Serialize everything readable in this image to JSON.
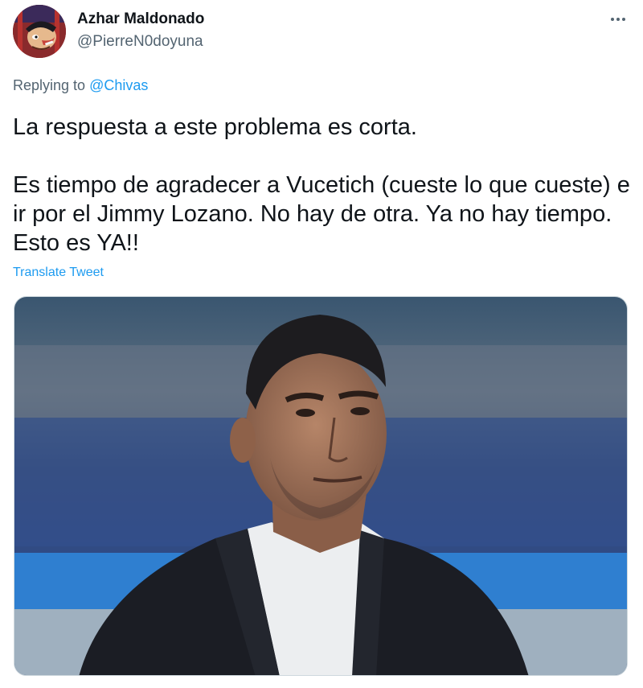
{
  "author": {
    "display_name": "Azhar Maldonado",
    "handle": "@PierreN0doyuna",
    "avatar_icon": "cartoon-avatar"
  },
  "reply": {
    "prefix": "Replying to",
    "mention": "@Chivas"
  },
  "tweet": {
    "paragraphs": [
      "La respuesta a este problema es corta.",
      "Es tiempo de agradecer a Vucetich (cueste lo que cueste) e ir por el Jimmy Lozano. No hay de otra. Ya no hay tiempo. Esto es YA!!"
    ],
    "translate_label": "Translate Tweet"
  },
  "media": {
    "type": "photo",
    "subject": "man-in-dark-suit-stadium"
  },
  "colors": {
    "text": "#0f1419",
    "secondary": "#536471",
    "link": "#1d9bf0",
    "border": "#cfd9de"
  }
}
